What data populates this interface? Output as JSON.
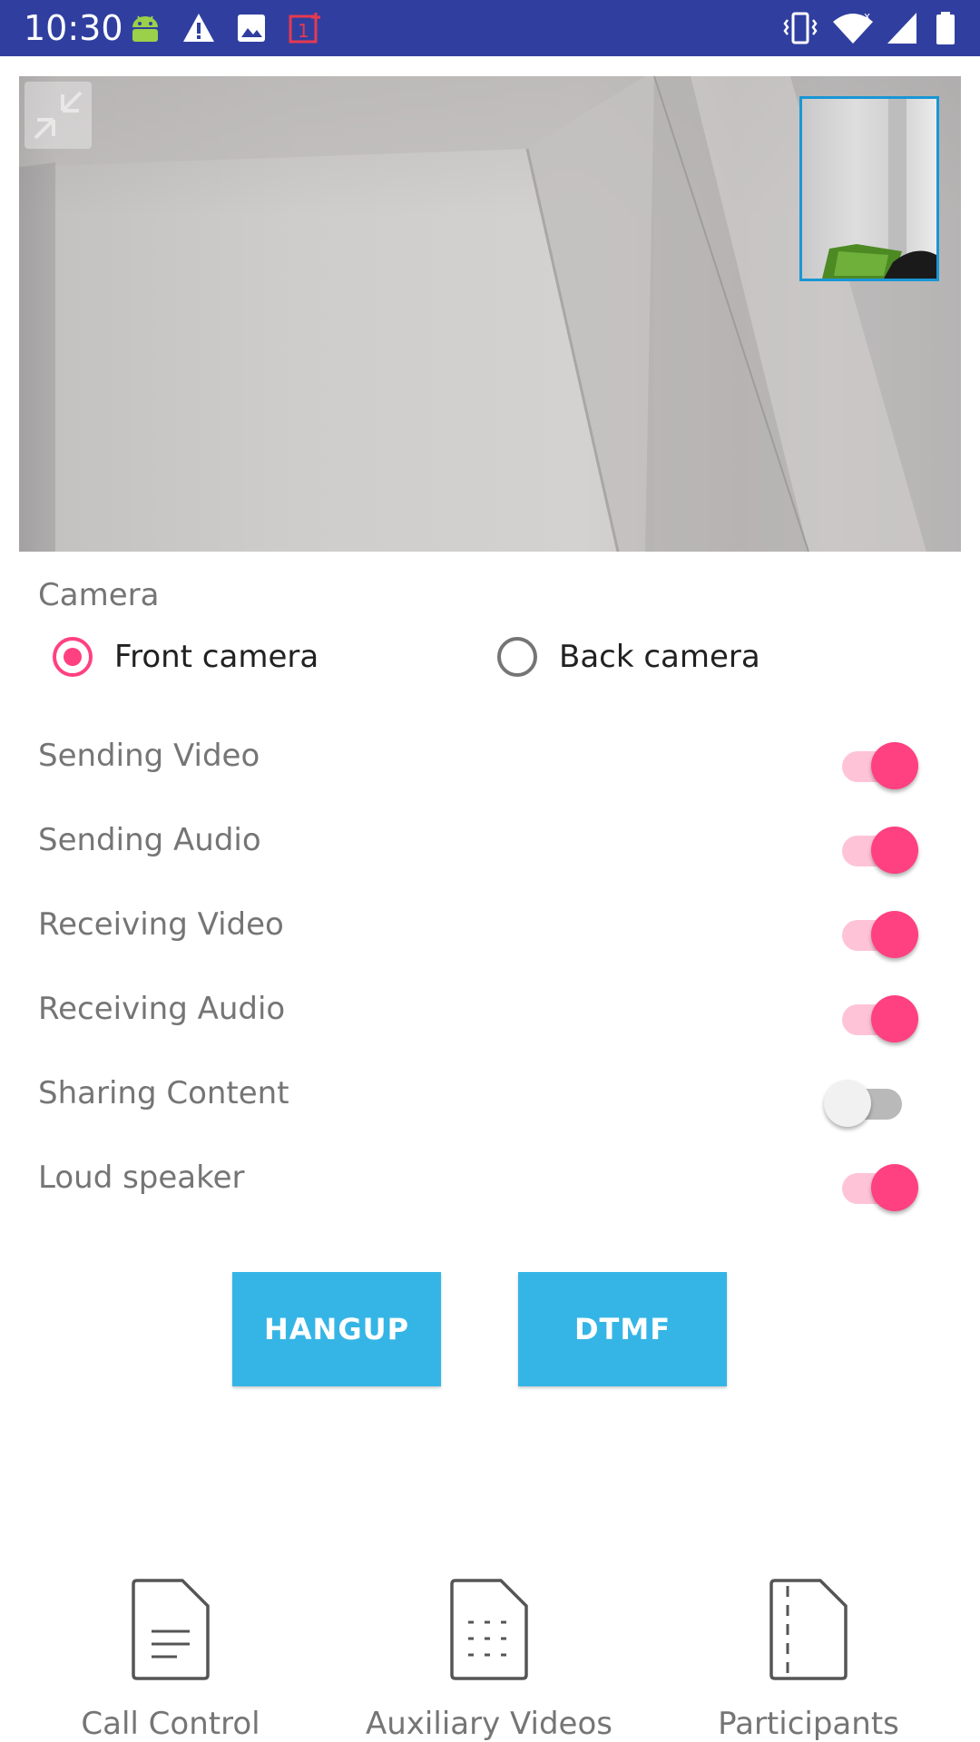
{
  "status_bar": {
    "time": "10:30",
    "left_icons": [
      "android-icon",
      "warning-icon",
      "image-icon",
      "oneplus-icon"
    ],
    "right_icons": [
      "vibrate-icon",
      "wifi-icon",
      "signal-icon",
      "battery-icon"
    ]
  },
  "camera": {
    "section_label": "Camera",
    "options": [
      {
        "label": "Front camera",
        "checked": true
      },
      {
        "label": "Back camera",
        "checked": false
      }
    ]
  },
  "settings": [
    {
      "label": "Sending Video",
      "on": true
    },
    {
      "label": "Sending Audio",
      "on": true
    },
    {
      "label": "Receiving Video",
      "on": true
    },
    {
      "label": "Receiving Audio",
      "on": true
    },
    {
      "label": "Sharing Content",
      "on": false
    },
    {
      "label": "Loud speaker",
      "on": true
    }
  ],
  "buttons": {
    "hangup": "HANGUP",
    "dtmf": "DTMF"
  },
  "bottom_tabs": [
    {
      "label": "Call Control",
      "icon": "document-lines-icon"
    },
    {
      "label": "Auxiliary Videos",
      "icon": "document-grid-icon"
    },
    {
      "label": "Participants",
      "icon": "document-dashed-icon"
    }
  ],
  "colors": {
    "status_bar": "#303f9f",
    "accent": "#ff4081",
    "button": "#35b5e6",
    "pip_border": "#1a96d4"
  }
}
